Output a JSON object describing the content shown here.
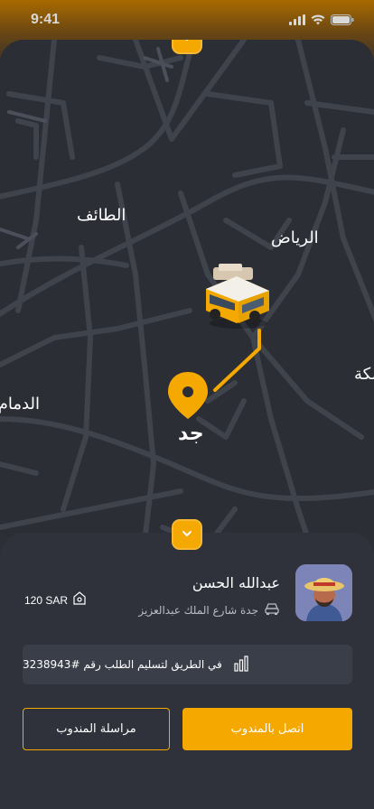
{
  "status_bar": {
    "time": "9:41"
  },
  "map": {
    "cities": {
      "taif": "الطائف",
      "riyadh": "الرياض",
      "dammam": "الدمام",
      "makkah": "مكة",
      "jeddah": "جد"
    },
    "route_color": "#f5a800",
    "pin_color": "#f5a800"
  },
  "driver": {
    "name": "عبدالله الحسن",
    "address": "جدة شارع الملك عبدالعزيز",
    "price": "120 SAR"
  },
  "order_status": "في الطريق لتسليم الطلب رقم #3238943",
  "actions": {
    "call_label": "اتصل بالمندوب",
    "message_label": "مراسلة المندوب"
  },
  "colors": {
    "accent": "#f5a800",
    "background": "#2b2e35",
    "sheet": "#2f323a"
  }
}
